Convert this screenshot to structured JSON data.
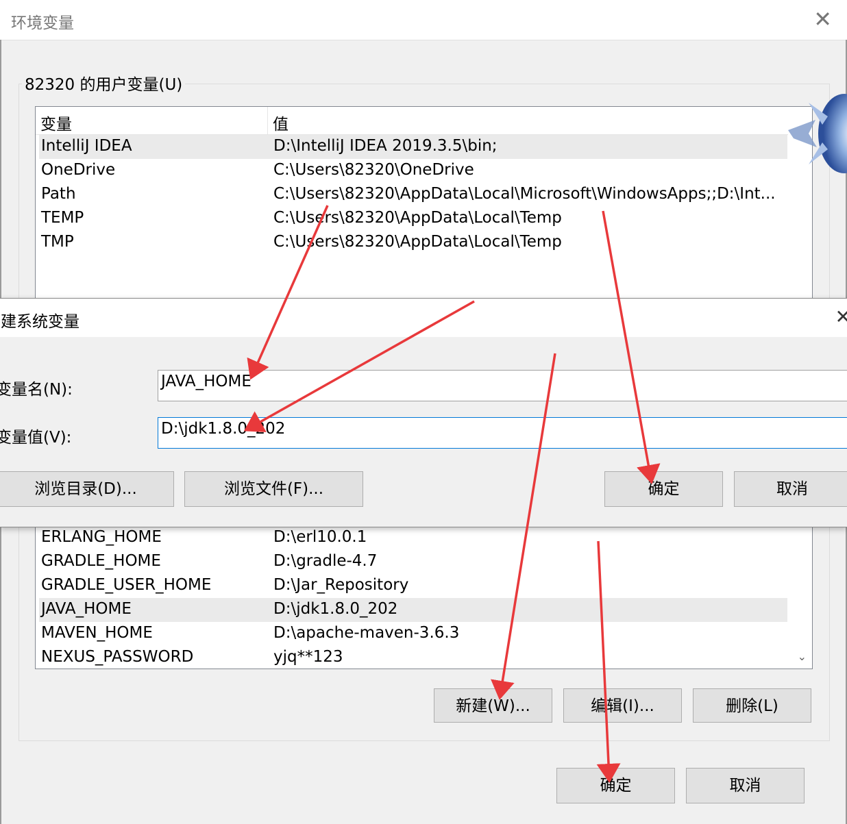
{
  "env_window": {
    "title": "环境变量",
    "close_glyph": "✕",
    "user_group_label": "82320 的用户变量(U)",
    "columns": {
      "name": "变量",
      "value": "值"
    },
    "user_variables": [
      {
        "name": "IntelliJ IDEA",
        "value": "D:\\IntelliJ IDEA 2019.3.5\\bin;"
      },
      {
        "name": "OneDrive",
        "value": "C:\\Users\\82320\\OneDrive"
      },
      {
        "name": "Path",
        "value": "C:\\Users\\82320\\AppData\\Local\\Microsoft\\WindowsApps;;D:\\Int..."
      },
      {
        "name": "TEMP",
        "value": "C:\\Users\\82320\\AppData\\Local\\Temp"
      },
      {
        "name": "TMP",
        "value": "C:\\Users\\82320\\AppData\\Local\\Temp"
      }
    ],
    "system_variables": [
      {
        "name": "ERLANG_HOME",
        "value": "D:\\erl10.0.1"
      },
      {
        "name": "GRADLE_HOME",
        "value": "D:\\gradle-4.7"
      },
      {
        "name": "GRADLE_USER_HOME",
        "value": "D:\\Jar_Repository"
      },
      {
        "name": "JAVA_HOME",
        "value": "D:\\jdk1.8.0_202"
      },
      {
        "name": "MAVEN_HOME",
        "value": "D:\\apache-maven-3.6.3"
      },
      {
        "name": "NEXUS_PASSWORD",
        "value": "yjq**123"
      }
    ],
    "system_buttons": {
      "new": "新建(W)...",
      "edit": "编辑(I)...",
      "delete": "删除(L)"
    },
    "footer_buttons": {
      "ok": "确定",
      "cancel": "取消"
    }
  },
  "new_dialog": {
    "title": "新建系统变量",
    "close_glyph": "✕",
    "name_label": "变量名(N):",
    "name_value": "JAVA_HOME",
    "value_label": "变量值(V):",
    "value_value": "D:\\jdk1.8.0_202",
    "buttons": {
      "browse_dir": "浏览目录(D)...",
      "browse_file": "浏览文件(F)...",
      "ok": "确定",
      "cancel": "取消"
    }
  },
  "icons": {
    "scroll_down": "chevron-down-icon",
    "crystal": "crystal-decoration"
  },
  "colors": {
    "arrow": "#e8393b",
    "focus_border": "#0078d7",
    "selected_row": "#eaeaea"
  }
}
